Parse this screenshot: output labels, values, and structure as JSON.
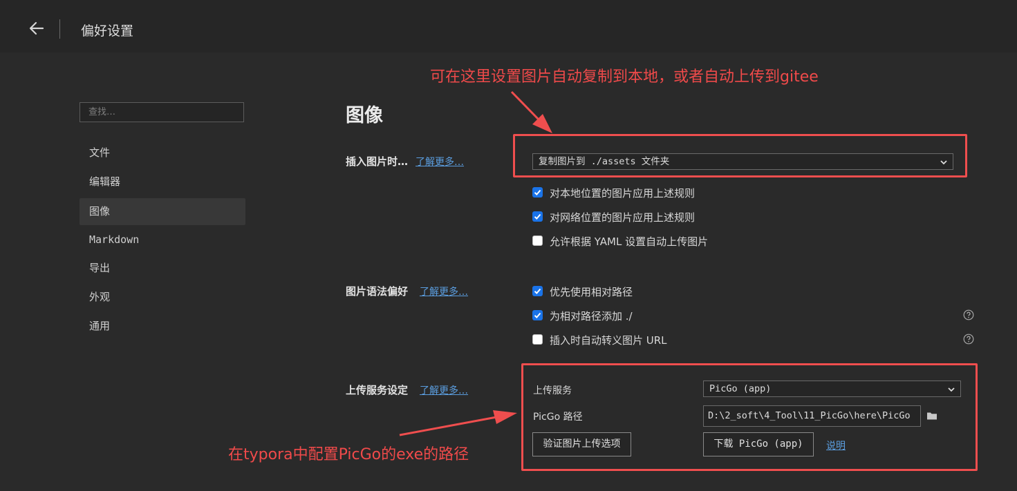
{
  "header": {
    "title": "偏好设置",
    "back_icon": "arrow-left-icon"
  },
  "sidebar": {
    "search_placeholder": "查找…",
    "items": [
      {
        "label": "文件",
        "active": false
      },
      {
        "label": "编辑器",
        "active": false
      },
      {
        "label": "图像",
        "active": true
      },
      {
        "label": "Markdown",
        "active": false
      },
      {
        "label": "导出",
        "active": false
      },
      {
        "label": "外观",
        "active": false
      },
      {
        "label": "通用",
        "active": false
      }
    ]
  },
  "main": {
    "section_title": "图像",
    "insert": {
      "label": "插入图片时…",
      "learn_more": "了解更多…",
      "select_value": "复制图片到 ./assets 文件夹",
      "checkboxes": [
        {
          "label": "对本地位置的图片应用上述规则",
          "checked": true
        },
        {
          "label": "对网络位置的图片应用上述规则",
          "checked": true
        },
        {
          "label": "允许根据 YAML 设置自动上传图片",
          "checked": false
        }
      ]
    },
    "syntax": {
      "label": "图片语法偏好",
      "learn_more": "了解更多…",
      "checkboxes": [
        {
          "label": "优先使用相对路径",
          "checked": true,
          "help": false
        },
        {
          "label": "为相对路径添加 ./",
          "checked": true,
          "help": true
        },
        {
          "label": "插入时自动转义图片 URL",
          "checked": false,
          "help": true
        }
      ]
    },
    "upload": {
      "label": "上传服务设定",
      "learn_more": "了解更多…",
      "service_label": "上传服务",
      "service_value": "PicGo (app)",
      "path_label": "PicGo 路径",
      "path_value": "D:\\2_soft\\4_Tool\\11_PicGo\\here\\PicGo",
      "verify_button": "验证图片上传选项",
      "download_button": "下载 PicGo (app)",
      "help_link": "说明"
    }
  },
  "annotations": {
    "top": "可在这里设置图片自动复制到本地，或者自动上传到gitee",
    "bottom": "在typora中配置PicGo的exe的路径"
  },
  "colors": {
    "accent_blue": "#1a73e8",
    "link": "#5b9ee0",
    "annotation_red": "#ef4e4e",
    "background": "#2a2a2a"
  }
}
